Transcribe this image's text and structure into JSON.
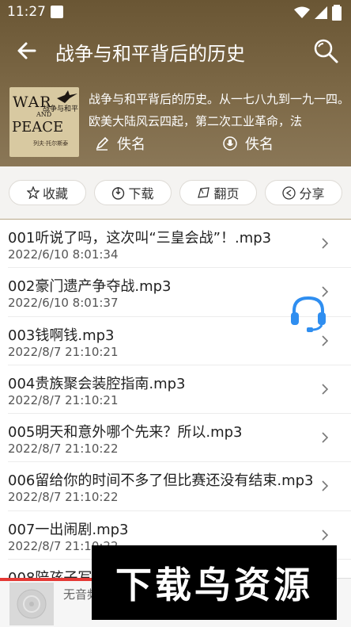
{
  "status_bar": {
    "time": "11:27"
  },
  "header": {
    "title": "战争与和平背后的历史",
    "description": "战争与和平背后的历史。从一七八九到一九一四。欧美大陆风云四起，第二次工业革命，法",
    "author": "佚名",
    "reader": "佚名",
    "cover": {
      "war": "WAR",
      "and": "AND",
      "peace": "PEACE",
      "cn_title": "战争与和平",
      "subtitle": "列夫·托尔斯泰"
    }
  },
  "actions": {
    "favorite": "收藏",
    "download": "下载",
    "page": "翻页",
    "share": "分享"
  },
  "episodes": [
    {
      "title": "001听说了吗，这次叫“三皇会战”！.mp3",
      "date": "2022/6/10 8:01:34"
    },
    {
      "title": "002豪门遗产争夺战.mp3",
      "date": "2022/6/10 8:01:37"
    },
    {
      "title": "003钱啊钱.mp3",
      "date": "2022/8/7 21:10:21"
    },
    {
      "title": "004贵族聚会装腔指南.mp3",
      "date": "2022/8/7 21:10:21"
    },
    {
      "title": "005明天和意外哪个先来？所以.mp3",
      "date": "2022/8/7 21:10:22"
    },
    {
      "title": "006留给你的时间不多了但比赛还没有结束.mp3",
      "date": "2022/8/7 21:10:22"
    },
    {
      "title": "007一出闹剧.mp3",
      "date": "2022/8/7 21:10:22"
    },
    {
      "title": "008陪孩子写",
      "date": ""
    }
  ],
  "player": {
    "status_text": "无音频"
  },
  "watermark": {
    "text": "下载鸟资源"
  },
  "colors": {
    "header_brown": "#7e6a48",
    "accent_blue": "#2f8ef0",
    "progress_red": "#e53935"
  }
}
